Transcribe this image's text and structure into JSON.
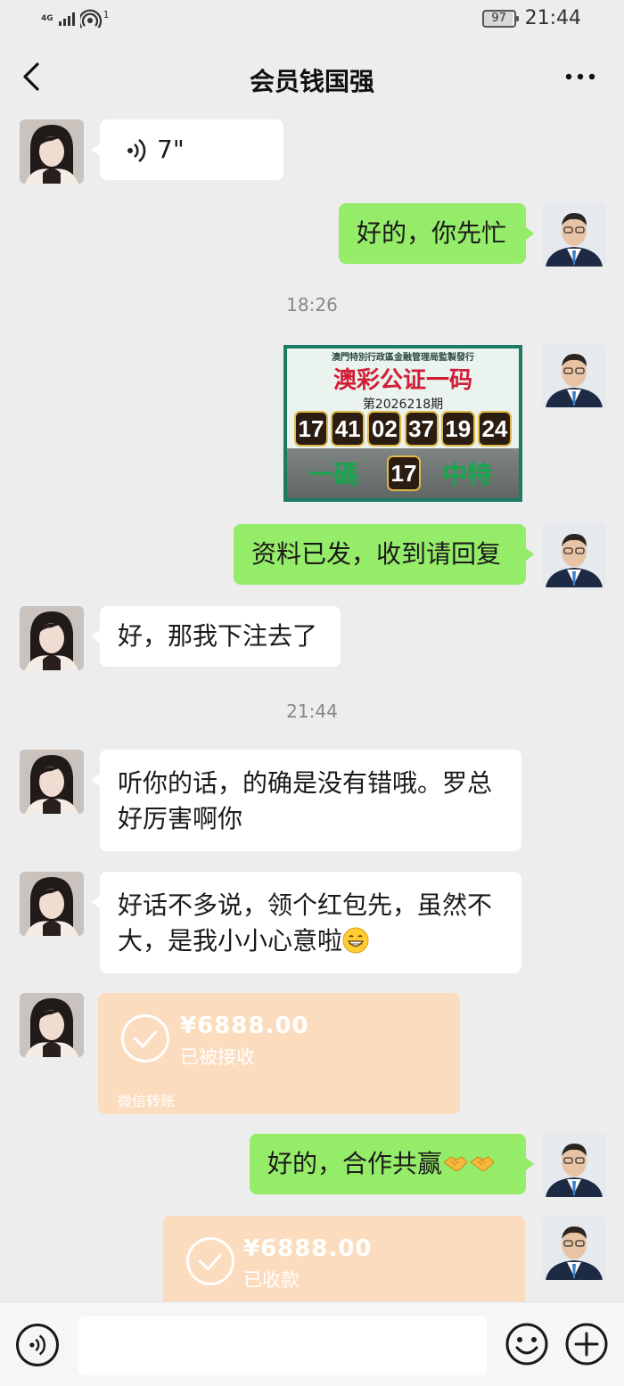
{
  "status": {
    "network": "4G",
    "signal_sub": "1",
    "battery": "97",
    "time": "21:44"
  },
  "header": {
    "title": "会员钱国强"
  },
  "voice_message": {
    "duration": "7\""
  },
  "messages": {
    "m1": "好的，你先忙",
    "m2": "资料已发，收到请回复",
    "m3": "好，那我下注去了",
    "m4": "听你的话，的确是没有错哦。罗总好厉害啊你",
    "m5": "好话不多说，领个红包先，虽然不大，是我小小心意啦",
    "m6": "好的，合作共赢"
  },
  "timestamps": {
    "t1": "18:26",
    "t2": "21:44"
  },
  "lottery_image": {
    "header": "澳門特別行政區金融管理局監製發行",
    "title": "澳彩公证一码",
    "period": "第2026218期",
    "numbers": [
      "17",
      "41",
      "02",
      "37",
      "19",
      "24"
    ],
    "bottom_left": "一碼",
    "special": "17",
    "bottom_right": "中特"
  },
  "transfers": {
    "received": {
      "amount": "¥6888.00",
      "status": "已被接收",
      "footer": "微信转账"
    },
    "collected": {
      "amount": "¥6888.00",
      "status": "已收款"
    }
  },
  "colors": {
    "out_bubble": "#95ec69",
    "in_bubble": "#ffffff",
    "transfer": "#fcdcbe",
    "background": "#ededed"
  },
  "icons": [
    "back-icon",
    "more-icon",
    "voice-wave-icon",
    "check-icon",
    "voice-input-icon",
    "emoji-icon",
    "plus-icon",
    "grin-emoji",
    "handshake-emoji"
  ]
}
